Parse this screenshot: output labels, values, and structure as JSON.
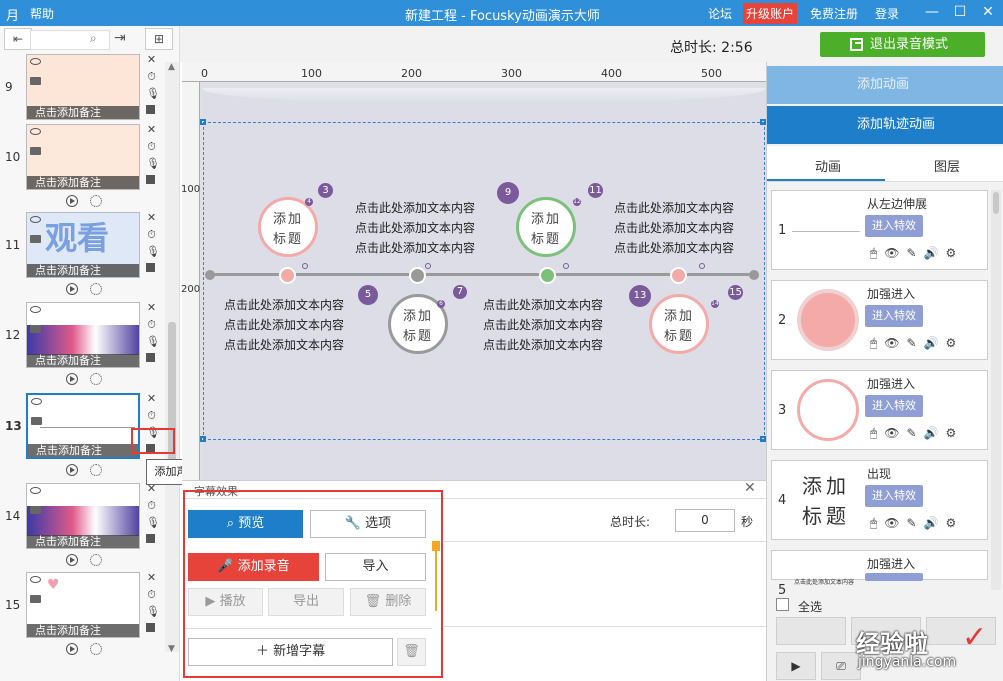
{
  "titlebar": {
    "menu_help": "帮助",
    "title": "新建工程 - Focusky动画演示大师",
    "forum": "论坛",
    "upgrade": "升级账户",
    "register": "免费注册",
    "login": "登录"
  },
  "toolbar": {
    "total_duration": "总时长: 2:56",
    "exit_record": "退出录音模式"
  },
  "slides": [
    {
      "number": "9",
      "note": "点击添加备注"
    },
    {
      "number": "10",
      "note": "点击添加备注"
    },
    {
      "number": "11",
      "note": "点击添加备注",
      "preview_text": "观看"
    },
    {
      "number": "12",
      "note": "点击添加备注"
    },
    {
      "number": "13",
      "note": "点击添加备注"
    },
    {
      "number": "14",
      "note": "点击添加备注"
    },
    {
      "number": "15",
      "note": "点击添加备注"
    }
  ],
  "tooltip": "添加声音跟字幕",
  "ruler": {
    "h_ticks": [
      "0",
      "100",
      "200",
      "300",
      "400",
      "500"
    ],
    "v_ticks": [
      "100",
      "200"
    ]
  },
  "canvas": {
    "title_text": "添加\n标题",
    "title_line1": "添加",
    "title_line2": "标题",
    "body_line": "点击此处添加文本内容",
    "badges": [
      "3",
      "4",
      "5",
      "6",
      "7",
      "9",
      "11",
      "12",
      "13",
      "14",
      "15"
    ]
  },
  "right_panel": {
    "add_animation": "添加动画",
    "add_path_animation": "添加轨迹动画",
    "tab_animation": "动画",
    "tab_layers": "图层",
    "enter_effect": "进入特效",
    "items": [
      {
        "index": "1",
        "name": "从左边伸展"
      },
      {
        "index": "2",
        "name": "加强进入"
      },
      {
        "index": "3",
        "name": "加强进入"
      },
      {
        "index": "4",
        "name": "出现",
        "preview": "添加标题",
        "preview_l1": "添加",
        "preview_l2": "标题"
      },
      {
        "index": "5",
        "name": "加强进入",
        "preview": "点击此处添加文本内容"
      }
    ],
    "select_all": "全选"
  },
  "audio_panel": {
    "header": "字幕效果",
    "preview": "预览",
    "options": "选项",
    "add_recording": "添加录音",
    "import": "导入",
    "play": "播放",
    "export": "导出",
    "delete": "删除",
    "add_subtitle": "新增字幕",
    "total_duration_label": "总时长:",
    "total_duration_value": "0",
    "unit_seconds": "秒"
  },
  "watermark": {
    "cn": "经验啦",
    "url": "jingyanla.com"
  },
  "colors": {
    "titlebar": "#2f8fd8",
    "upgrade": "#e8433a",
    "exit_green": "#4caf2a",
    "highlight_red": "#e53935",
    "primary_blue": "#1e7ec9",
    "badge_purple": "#7a5a9a",
    "pink": "#f4aaa8",
    "green": "#7cc17a"
  }
}
